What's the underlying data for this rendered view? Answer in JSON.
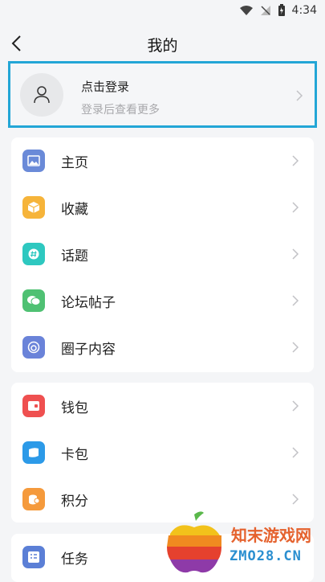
{
  "status_bar": {
    "time": "4:34"
  },
  "header": {
    "title": "我的"
  },
  "login": {
    "title": "点击登录",
    "subtitle": "登录后查看更多"
  },
  "section1": [
    {
      "label": "主页",
      "icon": "image-icon",
      "color": "#6a8ad8"
    },
    {
      "label": "收藏",
      "icon": "box-icon",
      "color": "#f6b43a"
    },
    {
      "label": "话题",
      "icon": "hashtag-icon",
      "color": "#2ec8c0"
    },
    {
      "label": "论坛帖子",
      "icon": "chat-bubbles-icon",
      "color": "#4fc173"
    },
    {
      "label": "圈子内容",
      "icon": "circle-content-icon",
      "color": "#6a83d9"
    }
  ],
  "section2": [
    {
      "label": "钱包",
      "icon": "wallet-icon",
      "color": "#ef5050"
    },
    {
      "label": "卡包",
      "icon": "card-icon",
      "color": "#2c9ae8"
    },
    {
      "label": "积分",
      "icon": "coins-icon",
      "color": "#f59a3c"
    }
  ],
  "section3": [
    {
      "label": "任务",
      "icon": "task-list-icon",
      "color": "#5b7fd6"
    }
  ],
  "watermark": {
    "line1": "知末游戏网",
    "line2": "ZMO28.CN"
  }
}
